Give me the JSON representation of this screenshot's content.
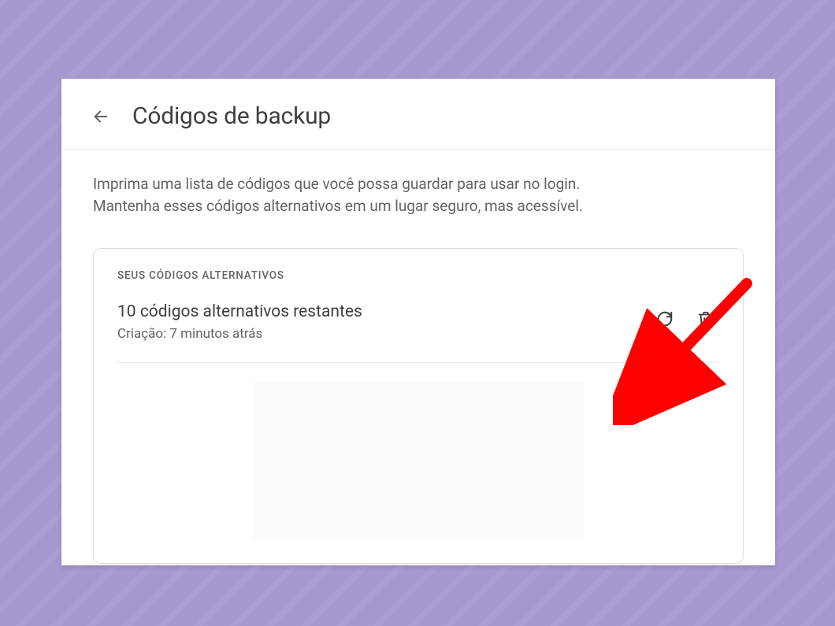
{
  "header": {
    "title": "Códigos de backup"
  },
  "description": {
    "line1": "Imprima uma lista de códigos que você possa guardar para usar no login.",
    "line2": "Mantenha esses códigos alternativos em um lugar seguro, mas acessível."
  },
  "card": {
    "label": "SEUS CÓDIGOS ALTERNATIVOS",
    "count_text": "10 códigos alternativos restantes",
    "created_text": "Criação: 7 minutos atrás"
  },
  "icons": {
    "back": "arrow-left-icon",
    "refresh": "refresh-icon",
    "delete": "trash-icon"
  },
  "annotation": {
    "arrow_color": "#ff0000"
  }
}
